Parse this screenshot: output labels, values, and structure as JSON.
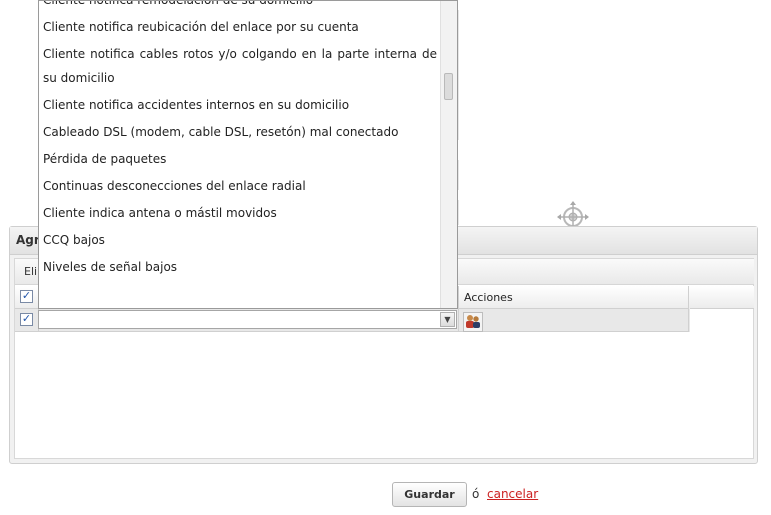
{
  "panel": {
    "title": "Agregar",
    "toolbar": {
      "delete_label": "Eliminar"
    },
    "grid": {
      "columns": [
        "",
        "",
        "Acciones"
      ],
      "header_checked": true,
      "row_checked": true,
      "row_select_value": "",
      "action_icon": "people-icon"
    }
  },
  "dropdown": {
    "items": [
      "Cliente notifica remodelación de su domicilio",
      "Cliente notifica reubicación del enlace por su cuenta",
      "Cliente notifica cables rotos y/o colgando en la parte interna de su domicilio",
      "Cliente notifica accidentes internos en su domicilio",
      "Cableado DSL (modem, cable DSL, resetón) mal conectado",
      "Pérdida de paquetes",
      "Continuas desconecciones del enlace radial",
      "Cliente indica antena o mástil movidos",
      "CCQ bajos",
      "Niveles de señal bajos"
    ]
  },
  "footer": {
    "save_label": "Guardar",
    "separator": "ó",
    "cancel_label": "cancelar"
  },
  "icons": {
    "move": "move-crosshair-icon",
    "chevron": "chevron-down-icon"
  },
  "colors": {
    "cancel_link": "#cc2222",
    "panel_bg": "#f1f1f1"
  }
}
